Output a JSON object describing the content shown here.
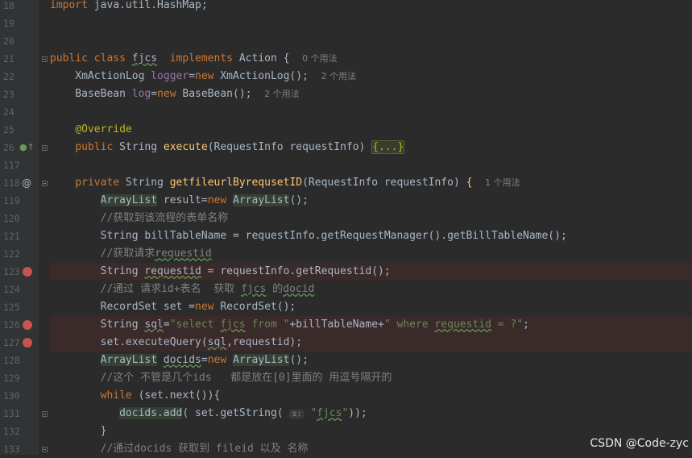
{
  "lines": [
    {
      "n": "18",
      "html": "<span class='kw'>import</span> java.util.HashMap;"
    },
    {
      "n": "19",
      "html": ""
    },
    {
      "n": "20",
      "html": ""
    },
    {
      "n": "21",
      "html": "<span class='kw'>public class</span> <span class='underline'>fjcs</span>  <span class='kw'>implements</span> Action {  <span class='hint'>0 个用法</span>"
    },
    {
      "n": "22",
      "html": "    XmActionLog <span class='fld'>logger</span>=<span class='kw'>new</span> XmActionLog();  <span class='hint'>2 个用法</span>"
    },
    {
      "n": "23",
      "html": "    BaseBean <span class='fld'>log</span>=<span class='kw'>new</span> BaseBean();  <span class='hint'>2 个用法</span>"
    },
    {
      "n": "24",
      "html": ""
    },
    {
      "n": "25",
      "html": "    <span class='ann'>@Override</span>"
    },
    {
      "n": "26",
      "html": "    <span class='kw'>public</span> String <span class='fn'>execute</span>(RequestInfo requestInfo) <span class='folded'>{...}</span>"
    },
    {
      "n": "117",
      "html": ""
    },
    {
      "n": "118",
      "html": "    <span class='kw'>private</span> String <span class='fn'>getfileurlByrequsetID</span>(RequestInfo requestInfo) <span class='fn'>{</span>  <span class='hint'>1 个用法</span>"
    },
    {
      "n": "119",
      "html": "        <span class='hl'>ArrayList</span> result=<span class='kw'>new</span> <span class='hl'>ArrayList</span>();"
    },
    {
      "n": "120",
      "html": "        <span class='cm'>//获取到该流程的表单名称</span>"
    },
    {
      "n": "121",
      "html": "        String billTableName = requestInfo.getRequestManager().getBillTableName();"
    },
    {
      "n": "122",
      "html": "        <span class='cm'>//获取请求<span class='underline'>requestid</span></span>"
    },
    {
      "n": "123",
      "html": "        String <span class='underline'>requestid</span> = requestInfo.getRequestid();"
    },
    {
      "n": "124",
      "html": "        <span class='cm'>//通过 请求id+表名  获取 <span class='underline'>fjcs</span> 的<span class='underline'>docid</span></span>"
    },
    {
      "n": "125",
      "html": "        RecordSet set =<span class='kw'>new</span> RecordSet();"
    },
    {
      "n": "126",
      "html": "        String <span class='underline'>sql</span>=<span class='str'>\"select <span class='underline'>fjcs</span> from \"</span>+billTableName+<span class='str'>\" where <span class='underline'>requestid</span> = ?\"</span>;"
    },
    {
      "n": "127",
      "html": "        set.executeQuery(<span class='underline'>sql</span>,requestid);"
    },
    {
      "n": "128",
      "html": "        <span class='hl'>ArrayList</span> <span class='underline'>docids</span>=<span class='kw'>new</span> <span class='hl'>ArrayList</span>();"
    },
    {
      "n": "129",
      "html": "        <span class='cm'>//这个 不管是几个ids   都是放在[0]里面的 用逗号隔开的</span>"
    },
    {
      "n": "130",
      "html": "        <span class='kw'>while</span> (set.next()){"
    },
    {
      "n": "131",
      "html": "           <span class='hl'>docids.add</span>( set.getString( <span class='pmhint'>s:</span> <span class='str'>\"<span class='underline'>fjcs</span>\"</span>));"
    },
    {
      "n": "132",
      "html": "        }"
    },
    {
      "n": "133",
      "html": "        <span class='cm'>//通过docids 获取到 fileid 以及 名称</span>"
    }
  ],
  "breakpoints": [
    "123",
    "126",
    "127"
  ],
  "watermark": "CSDN @Code-zyc"
}
